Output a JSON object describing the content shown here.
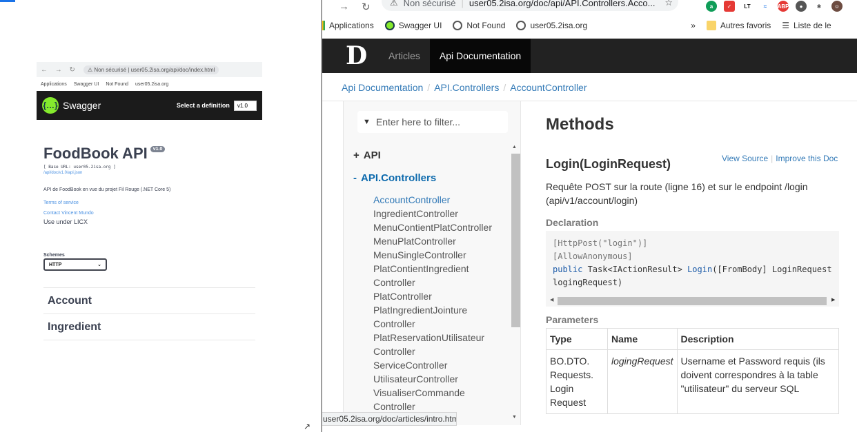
{
  "thumbnail": {
    "address": {
      "insecure": "Non sécurisé",
      "url": "user05.2isa.org/api/doc/index.html"
    },
    "bookmarks": [
      "Applications",
      "Swagger UI",
      "Not Found",
      "user05.2isa.org"
    ],
    "swagger_name": "Swagger",
    "select_definition": "Select a definition",
    "version_selected": "v1.0",
    "api_title": "FoodBook API",
    "version_badge": "v1.0",
    "base_url": "[ Base URL: user05.2isa.org ]",
    "json_link": "/api/doc/v1.0/api.json",
    "description": "API de FoodBook en vue du projet Fil Rouge (.NET Core 5)",
    "terms": "Terms of service",
    "contact": "Contact Vincent Mundo",
    "license": "Use under LICX",
    "schemes_label": "Schemes",
    "scheme_selected": "HTTP",
    "sections": [
      "Account",
      "Ingredient"
    ]
  },
  "browser": {
    "insecure_label": "Non sécurisé",
    "url": "user05.2isa.org/doc/api/API.Controllers.Acco...",
    "bookmarks": [
      "Applications",
      "Swagger UI",
      "Not Found",
      "user05.2isa.org"
    ],
    "bookmarks_more": "»",
    "other_bookmarks": "Autres favoris",
    "reading_list": "Liste de le",
    "status_url": "user05.2isa.org/doc/articles/intro.html",
    "colors": {
      "nav_bg": "#222222",
      "link": "#337ab7",
      "active_toc": "#0d6aad"
    }
  },
  "docfx": {
    "logo": "D",
    "tabs": [
      "Articles",
      "Api Documentation"
    ],
    "breadcrumb": [
      "Api Documentation",
      "API.Controllers",
      "AccountController"
    ],
    "filter_placeholder": "Enter here to filter...",
    "toc": {
      "api": "API",
      "controllers": "API.Controllers",
      "items": [
        "AccountController",
        "IngredientController",
        "MenuContientPlatController",
        "MenuPlatController",
        "MenuSingleController",
        "PlatContientIngredient",
        "Controller",
        "PlatController",
        "PlatIngredientJointure",
        "Controller",
        "PlatReservationUtilisateur",
        "Controller",
        "ServiceController",
        "UtilisateurController",
        "VisualiserCommande",
        "Controller"
      ]
    },
    "methods_heading": "Methods",
    "method_title": "Login(LoginRequest)",
    "view_source": "View Source",
    "improve_doc": "Improve this Doc",
    "summary": "Requête POST sur la route (ligne 16) et sur le endpoint /login (api/v1/account/login)",
    "declaration_label": "Declaration",
    "code": {
      "line1": "[HttpPost(\"login\")]",
      "line2": "[AllowAnonymous]",
      "kw_public": "public",
      "task": " Task<IActionResult> ",
      "fn": "Login",
      "args": "([FromBody] LoginRequest",
      "line4": "logingRequest)"
    },
    "parameters_label": "Parameters",
    "table": {
      "headers": [
        "Type",
        "Name",
        "Description"
      ],
      "type_lines": [
        "BO.DTO.",
        "Requests.",
        "Login",
        "Request"
      ],
      "name": "logingRequest",
      "description": "Username et Password requis (ils doivent correspondres à la table \"utilisateur\" du serveur SQL"
    }
  }
}
